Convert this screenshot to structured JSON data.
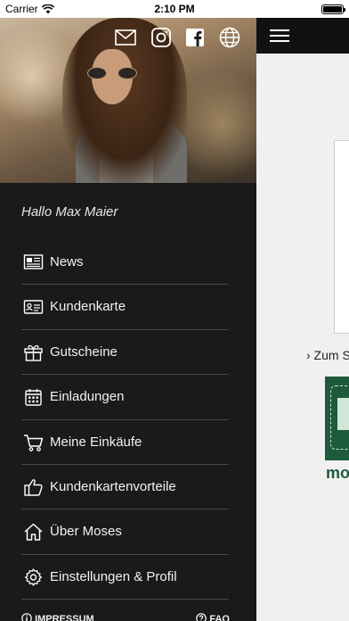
{
  "status_bar": {
    "carrier": "Carrier",
    "time": "2:10 PM"
  },
  "hero": {
    "icons": [
      "mail-icon",
      "instagram-icon",
      "facebook-icon",
      "globe-icon"
    ]
  },
  "drawer": {
    "greeting": "Hallo Max Maier",
    "items": [
      {
        "label": "News",
        "icon": "newspaper-icon"
      },
      {
        "label": "Kundenkarte",
        "icon": "customer-card-icon"
      },
      {
        "label": "Gutscheine",
        "icon": "gift-icon"
      },
      {
        "label": "Einladungen",
        "icon": "calendar-icon"
      },
      {
        "label": "Meine Einkäufe",
        "icon": "shopping-cart-icon"
      },
      {
        "label": "Kundenkartenvorteile",
        "icon": "thumbs-up-icon"
      },
      {
        "label": "Über Moses",
        "icon": "home-icon"
      },
      {
        "label": "Einstellungen & Profil",
        "icon": "settings-icon"
      }
    ],
    "footer": {
      "impressum": "IMPRESSUM",
      "faq": "FAQ"
    }
  },
  "main": {
    "link_text": "› Zum S",
    "promo_text": "mo"
  },
  "colors": {
    "drawer_bg": "#1a1a1a",
    "brand_green": "#1d5b3a",
    "header_bg": "#111111"
  }
}
